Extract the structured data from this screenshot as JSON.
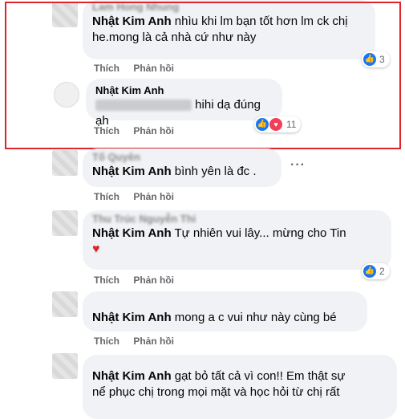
{
  "actions": {
    "like": "Thích",
    "reply": "Phản hồi"
  },
  "comments": [
    {
      "author": "Lam Hong Nhung",
      "mention": "Nhật Kim Anh",
      "text_line1": "nhìu khi lm bạn tốt hơn lm ck chị",
      "text_line2": "he.mong là cả nhà cứ như này",
      "reactions": "3"
    },
    {
      "author": "Nhật Kim Anh",
      "text": "hihi dạ đúng ạh",
      "reactions": "11"
    },
    {
      "author": "Tố Quyên",
      "mention": "Nhật Kim Anh",
      "text": "bình yên là đc ."
    },
    {
      "author": "Thu Trúc Nguyễn Thi",
      "mention": "Nhật Kim Anh",
      "text": "Tự nhiên vui lây... mừng cho Tin",
      "emoji": "♥",
      "reactions": "2"
    },
    {
      "author": "",
      "mention": "Nhật Kim Anh",
      "text": "mong a c vui như này cùng bé"
    },
    {
      "author": "",
      "mention": "Nhật Kim Anh",
      "text_line1": "gạt bỏ tất cả vì con!! Em thật sự",
      "text_line2": "nể phục chị trong mọi mặt và học hỏi từ chị rất"
    }
  ],
  "colors": {
    "highlight": "#e0242c",
    "like_blue": "#1877f2",
    "heart_red": "#f33e58"
  }
}
